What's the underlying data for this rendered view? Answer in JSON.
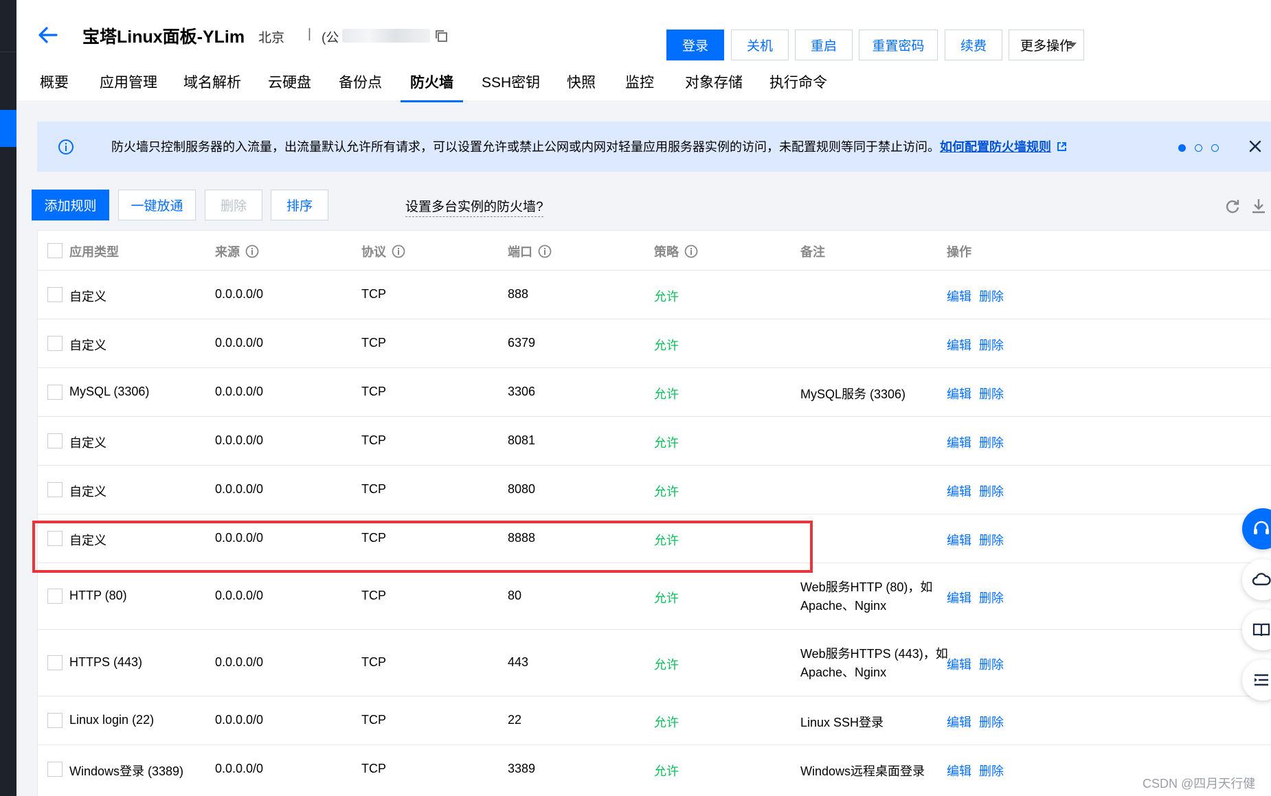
{
  "header": {
    "title": "宝塔Linux面板-YLim",
    "region": "北京",
    "separator": "|",
    "ip_prefix": "(公",
    "buttons": {
      "login": "登录",
      "shutdown": "关机",
      "restart": "重启",
      "reset_password": "重置密码",
      "renew": "续费",
      "more": "更多操作"
    }
  },
  "tabs": [
    "概要",
    "应用管理",
    "域名解析",
    "云硬盘",
    "备份点",
    "防火墙",
    "SSH密钥",
    "快照",
    "监控",
    "对象存储",
    "执行命令"
  ],
  "active_tab": "防火墙",
  "notice": {
    "text": "防火墙只控制服务器的入流量，出流量默认允许所有请求，可以设置允许或禁止公网或内网对轻量应用服务器实例的访问，未配置规则等同于禁止访问。",
    "link": "如何配置防火墙规则"
  },
  "toolbar": {
    "add_rule": "添加规则",
    "open_all": "一键放通",
    "delete": "删除",
    "sort": "排序",
    "multi_instance": "设置多台实例的防火墙?"
  },
  "table": {
    "headers": {
      "app_type": "应用类型",
      "source": "来源",
      "protocol": "协议",
      "port": "端口",
      "policy": "策略",
      "note": "备注",
      "actions": "操作"
    },
    "rows": [
      {
        "app_type": "自定义",
        "source": "0.0.0.0/0",
        "protocol": "TCP",
        "port": "888",
        "policy": "允许",
        "note": ""
      },
      {
        "app_type": "自定义",
        "source": "0.0.0.0/0",
        "protocol": "TCP",
        "port": "6379",
        "policy": "允许",
        "note": ""
      },
      {
        "app_type": "MySQL (3306)",
        "source": "0.0.0.0/0",
        "protocol": "TCP",
        "port": "3306",
        "policy": "允许",
        "note": "MySQL服务 (3306)"
      },
      {
        "app_type": "自定义",
        "source": "0.0.0.0/0",
        "protocol": "TCP",
        "port": "8081",
        "policy": "允许",
        "note": ""
      },
      {
        "app_type": "自定义",
        "source": "0.0.0.0/0",
        "protocol": "TCP",
        "port": "8080",
        "policy": "允许",
        "note": ""
      },
      {
        "app_type": "自定义",
        "source": "0.0.0.0/0",
        "protocol": "TCP",
        "port": "8888",
        "policy": "允许",
        "note": ""
      },
      {
        "app_type": "HTTP (80)",
        "source": "0.0.0.0/0",
        "protocol": "TCP",
        "port": "80",
        "policy": "允许",
        "note": "Web服务HTTP (80)，如Apache、Nginx"
      },
      {
        "app_type": "HTTPS (443)",
        "source": "0.0.0.0/0",
        "protocol": "TCP",
        "port": "443",
        "policy": "允许",
        "note": "Web服务HTTPS (443)，如Apache、Nginx"
      },
      {
        "app_type": "Linux login (22)",
        "source": "0.0.0.0/0",
        "protocol": "TCP",
        "port": "22",
        "policy": "允许",
        "note": "Linux SSH登录"
      },
      {
        "app_type": "Windows登录 (3389)",
        "source": "0.0.0.0/0",
        "protocol": "TCP",
        "port": "3389",
        "policy": "允许",
        "note": "Windows远程桌面登录"
      }
    ],
    "edit_label": "编辑",
    "delete_label": "删除"
  },
  "watermark": "CSDN @四月天行健",
  "colors": {
    "primary": "#006eff",
    "allow": "#0abf5b",
    "highlight": "#e8363b",
    "notice_bg": "#dde9ff"
  }
}
